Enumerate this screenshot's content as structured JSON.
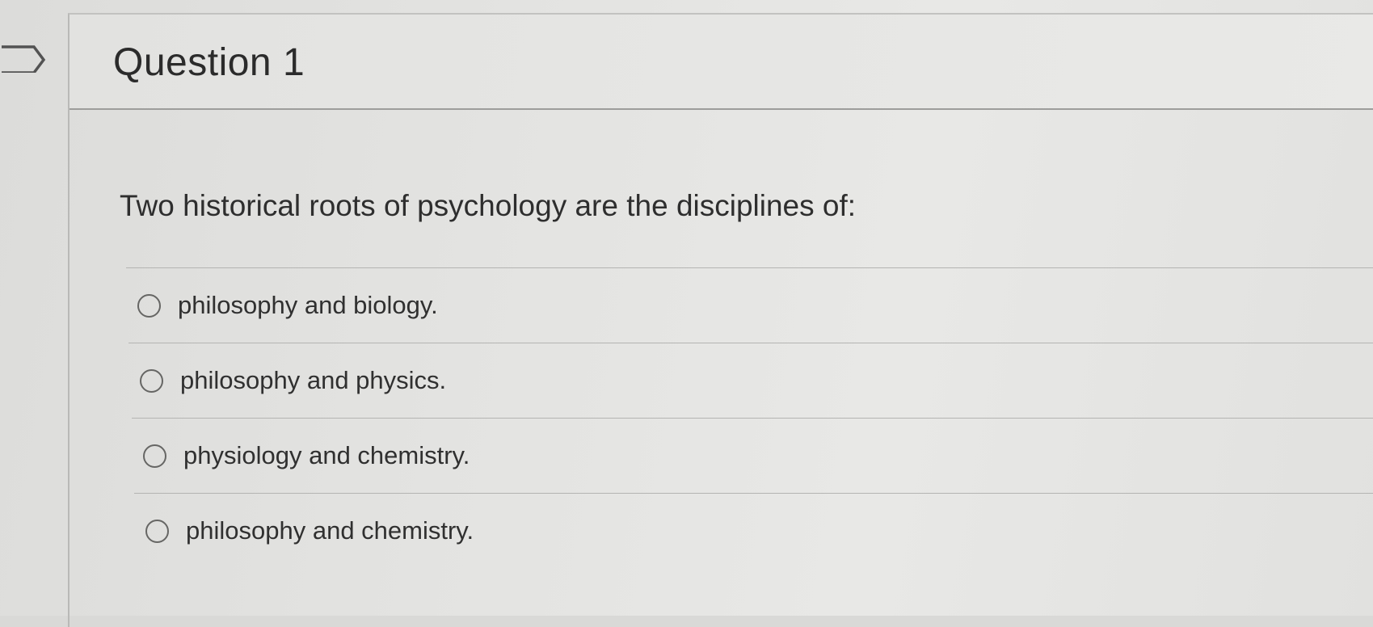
{
  "question": {
    "title": "Question 1",
    "prompt": "Two historical roots of psychology are the disciplines of:"
  },
  "answers": [
    {
      "label": "philosophy and biology."
    },
    {
      "label": "philosophy and physics."
    },
    {
      "label": "physiology and chemistry."
    },
    {
      "label": "philosophy and chemistry."
    }
  ]
}
